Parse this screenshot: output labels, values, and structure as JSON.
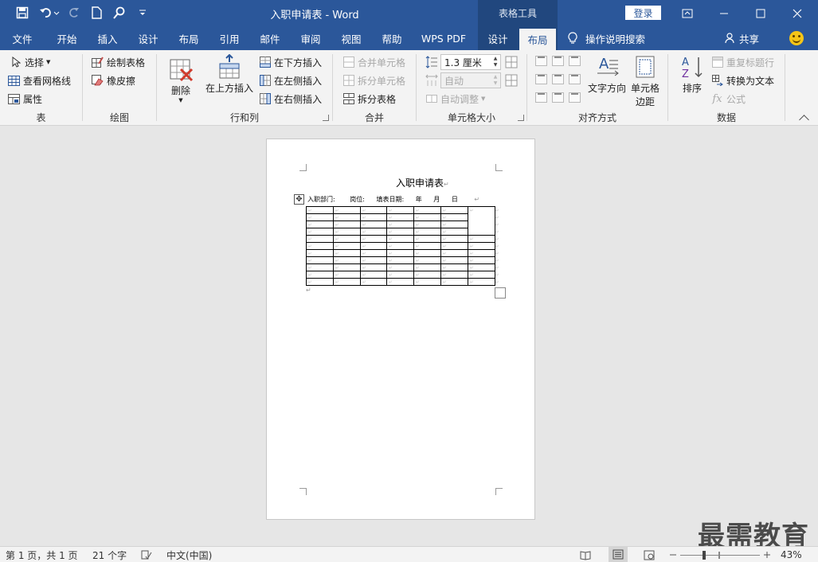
{
  "app": {
    "title": "入职申请表  -  Word",
    "context_group": "表格工具",
    "login_label": "登录"
  },
  "tabs": [
    {
      "label": "文件"
    },
    {
      "label": "开始"
    },
    {
      "label": "插入"
    },
    {
      "label": "设计"
    },
    {
      "label": "布局"
    },
    {
      "label": "引用"
    },
    {
      "label": "邮件"
    },
    {
      "label": "审阅"
    },
    {
      "label": "视图"
    },
    {
      "label": "帮助"
    },
    {
      "label": "WPS PDF"
    },
    {
      "label": "设计"
    },
    {
      "label": "布局"
    }
  ],
  "search_label": "操作说明搜索",
  "share_label": "共享",
  "ribbon": {
    "table": {
      "label": "表",
      "select": "选择",
      "view_grid": "查看网格线",
      "properties": "属性"
    },
    "draw": {
      "label": "绘图",
      "draw_table": "绘制表格",
      "eraser": "橡皮擦"
    },
    "rows_cols": {
      "label": "行和列",
      "delete": "删除",
      "insert_above": "在上方插入",
      "insert_below": "在下方插入",
      "insert_left": "在左侧插入",
      "insert_right": "在右侧插入"
    },
    "merge": {
      "label": "合并",
      "merge_cells": "合并单元格",
      "split_cells": "拆分单元格",
      "split_table": "拆分表格"
    },
    "cell_size": {
      "label": "单元格大小",
      "height_value": "1.3 厘米",
      "width_value": "自动",
      "autofit": "自动调整"
    },
    "alignment": {
      "label": "对齐方式",
      "text_direction": "文字方向",
      "cell_margins_1": "单元格",
      "cell_margins_2": "边距"
    },
    "data": {
      "label": "数据",
      "sort": "排序",
      "repeat_header": "重复标题行",
      "convert_text": "转换为文本",
      "formula": "公式"
    }
  },
  "document": {
    "title": "入职申请表",
    "dept": "入职部门:",
    "position": "岗位:",
    "date": "填表日期:",
    "year": "年",
    "month": "月",
    "day": "日"
  },
  "watermark": "最需教育",
  "status": {
    "page": "第 1 页，共 1 页",
    "words": "21 个字",
    "language": "中文(中国)",
    "zoom": "43%"
  }
}
